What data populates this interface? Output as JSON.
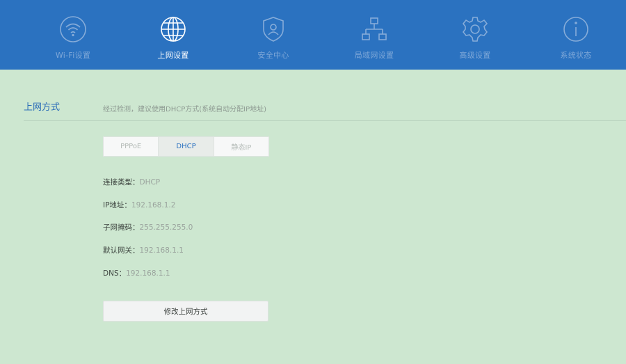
{
  "nav": {
    "items": [
      {
        "label": "Wi-Fi设置",
        "icon": "wifi-icon"
      },
      {
        "label": "上网设置",
        "icon": "globe-icon",
        "active": true
      },
      {
        "label": "安全中心",
        "icon": "shield-user-icon"
      },
      {
        "label": "局域网设置",
        "icon": "lan-topology-icon"
      },
      {
        "label": "高级设置",
        "icon": "gear-icon"
      },
      {
        "label": "系统状态",
        "icon": "info-icon"
      }
    ]
  },
  "section": {
    "title": "上网方式",
    "hint": "经过检测，建议使用DHCP方式(系统自动分配IP地址)"
  },
  "tabs": {
    "pppoe": "PPPoE",
    "dhcp": "DHCP",
    "static": "静态IP",
    "selected": "DHCP"
  },
  "info": {
    "conn_type_label": "连接类型：",
    "conn_type_value": "DHCP",
    "ip_label": "IP地址：",
    "ip_value": "192.168.1.2",
    "mask_label": "子网掩码：",
    "mask_value": "255.255.255.0",
    "gateway_label": "默认网关：",
    "gateway_value": "192.168.1.1",
    "dns_label": "DNS：",
    "dns_value": "192.168.1.1"
  },
  "actions": {
    "change_label": "修改上网方式"
  },
  "colors": {
    "header_bg": "#2b72c0",
    "page_bg": "#cde7d0",
    "accent": "#2b72c0"
  }
}
